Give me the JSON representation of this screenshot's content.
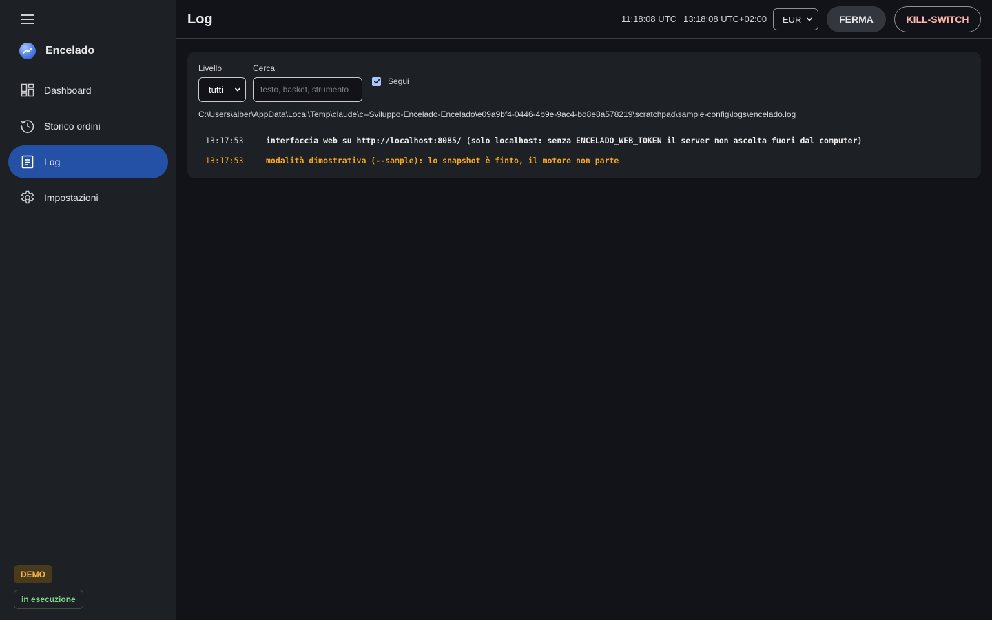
{
  "app": {
    "name": "Encelado"
  },
  "nav": {
    "items": [
      {
        "label": "Dashboard",
        "icon": "dashboard-icon"
      },
      {
        "label": "Storico ordini",
        "icon": "history-icon"
      },
      {
        "label": "Log",
        "icon": "document-icon",
        "active": true
      },
      {
        "label": "Impostazioni",
        "icon": "gear-icon"
      }
    ]
  },
  "status": {
    "mode": "DEMO",
    "state": "in esecuzione"
  },
  "header": {
    "title": "Log",
    "utc_time": "11:18:08 UTC",
    "local_time": "13:18:08 UTC+02:00",
    "currency": "EUR",
    "stop_label": "FERMA",
    "kill_label": "KILL-SWITCH"
  },
  "filters": {
    "level_label": "Livello",
    "level_value": "tutti",
    "search_label": "Cerca",
    "search_placeholder": "testo, basket, strumento",
    "search_value": "",
    "follow_label": "Segui",
    "follow_checked": true
  },
  "log": {
    "path": "C:\\Users\\alber\\AppData\\Local\\Temp\\claude\\c--Sviluppo-Encelado-Encelado\\e09a9bf4-0446-4b9e-9ac4-bd8e8a578219\\scratchpad\\sample-config\\logs\\encelado.log",
    "lines": [
      {
        "time": "13:17:53",
        "message": "interfaccia web su http://localhost:8085/ (solo localhost: senza ENCELADO_WEB_TOKEN il server non ascolta fuori dal computer)",
        "level": "info"
      },
      {
        "time": "13:17:53",
        "message": "modalità dimostrativa (--sample): lo snapshot è finto, il motore non parte",
        "level": "warning"
      }
    ]
  },
  "colors": {
    "accent": "#2450a6",
    "warning": "#f5a623",
    "danger": "#ffb4ab",
    "success": "#7fd68a"
  }
}
